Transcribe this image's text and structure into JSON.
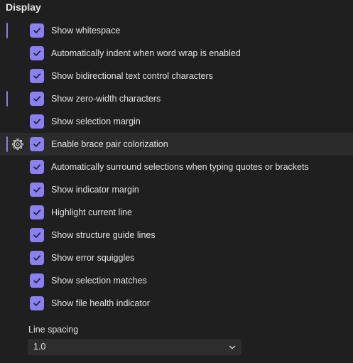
{
  "section": {
    "title": "Display"
  },
  "options": [
    {
      "label": "Show whitespace",
      "checked": true,
      "modified": true,
      "hover": false
    },
    {
      "label": "Automatically indent when word wrap is enabled",
      "checked": true,
      "modified": false,
      "hover": false
    },
    {
      "label": "Show bidirectional text control characters",
      "checked": true,
      "modified": false,
      "hover": false
    },
    {
      "label": "Show zero-width characters",
      "checked": true,
      "modified": true,
      "hover": false
    },
    {
      "label": "Show selection margin",
      "checked": true,
      "modified": false,
      "hover": false
    },
    {
      "label": "Enable brace pair colorization",
      "checked": true,
      "modified": true,
      "hover": true,
      "icon": "gear-icon"
    },
    {
      "label": "Automatically surround selections when typing quotes or brackets",
      "checked": true,
      "modified": false,
      "hover": false
    },
    {
      "label": "Show indicator margin",
      "checked": true,
      "modified": false,
      "hover": false
    },
    {
      "label": "Highlight current line",
      "checked": true,
      "modified": false,
      "hover": false
    },
    {
      "label": "Show structure guide lines",
      "checked": true,
      "modified": false,
      "hover": false
    },
    {
      "label": "Show error squiggles",
      "checked": true,
      "modified": false,
      "hover": false
    },
    {
      "label": "Show selection matches",
      "checked": true,
      "modified": false,
      "hover": false
    },
    {
      "label": "Show file health indicator",
      "checked": true,
      "modified": false,
      "hover": false
    }
  ],
  "line_spacing": {
    "label": "Line spacing",
    "value": "1.0",
    "icon": "chevron-down-icon"
  },
  "colors": {
    "background": "#1f1f1f",
    "accent": "#8b7ff2",
    "modified_marker": "#8a7cf0",
    "hover_row": "#2b2b2b",
    "dropdown_bg": "#2d2d2d"
  }
}
